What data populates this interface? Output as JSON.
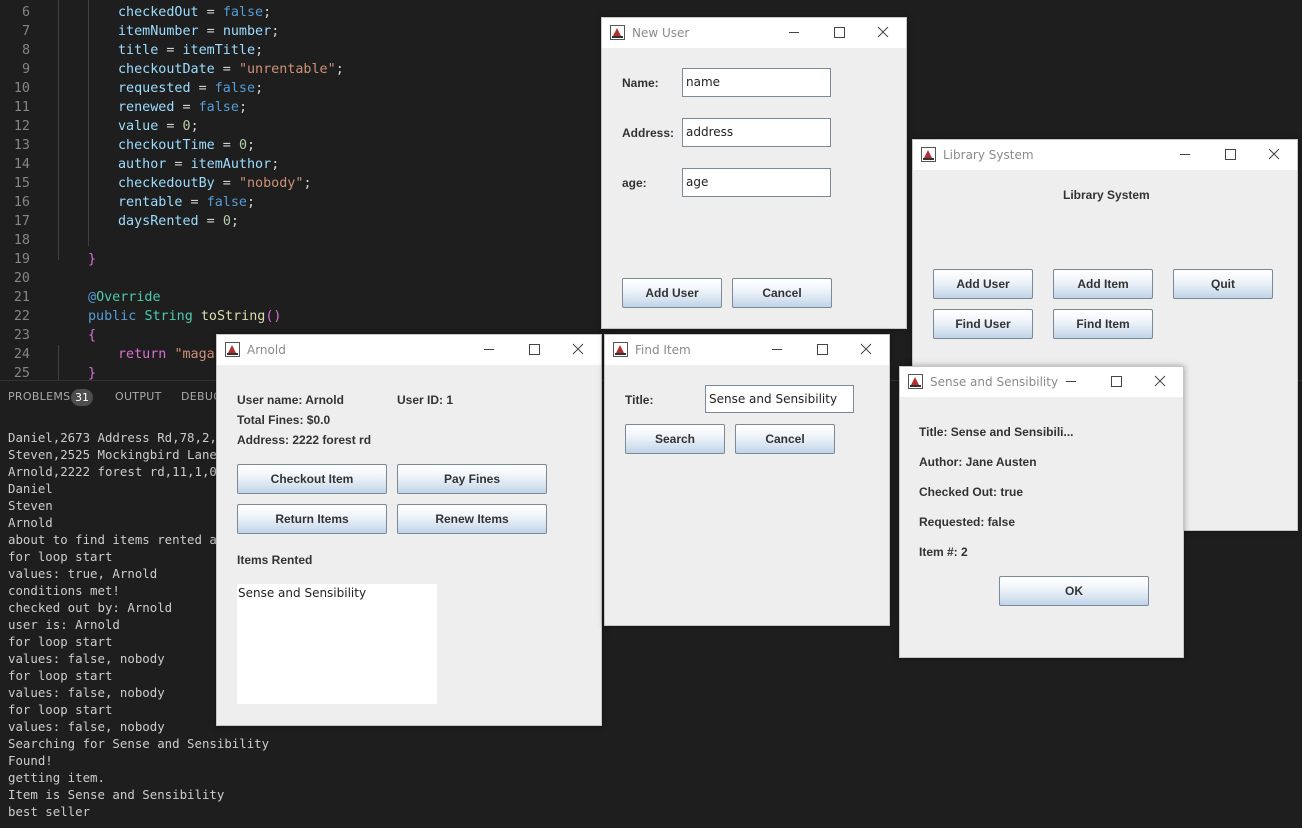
{
  "editor": {
    "lines": [
      {
        "num": "6",
        "tokens": [
          {
            "t": "checkedOut",
            "c": "v"
          },
          {
            "t": " = "
          },
          {
            "t": "false",
            "c": "k"
          },
          {
            "t": ";"
          }
        ]
      },
      {
        "num": "7",
        "tokens": [
          {
            "t": "itemNumber",
            "c": "v"
          },
          {
            "t": " = "
          },
          {
            "t": "number",
            "c": "v"
          },
          {
            "t": ";"
          }
        ]
      },
      {
        "num": "8",
        "tokens": [
          {
            "t": "title",
            "c": "v"
          },
          {
            "t": " = "
          },
          {
            "t": "itemTitle",
            "c": "v"
          },
          {
            "t": ";"
          }
        ]
      },
      {
        "num": "9",
        "tokens": [
          {
            "t": "checkoutDate",
            "c": "v"
          },
          {
            "t": " = "
          },
          {
            "t": "\"unrentable\"",
            "c": "s"
          },
          {
            "t": ";"
          }
        ]
      },
      {
        "num": "10",
        "tokens": [
          {
            "t": "requested",
            "c": "v"
          },
          {
            "t": " = "
          },
          {
            "t": "false",
            "c": "k"
          },
          {
            "t": ";"
          }
        ]
      },
      {
        "num": "11",
        "tokens": [
          {
            "t": "renewed",
            "c": "v"
          },
          {
            "t": " = "
          },
          {
            "t": "false",
            "c": "k"
          },
          {
            "t": ";"
          }
        ]
      },
      {
        "num": "12",
        "tokens": [
          {
            "t": "value",
            "c": "v"
          },
          {
            "t": " = "
          },
          {
            "t": "0",
            "c": "n"
          },
          {
            "t": ";"
          }
        ]
      },
      {
        "num": "13",
        "tokens": [
          {
            "t": "checkoutTime",
            "c": "v"
          },
          {
            "t": " = "
          },
          {
            "t": "0",
            "c": "n"
          },
          {
            "t": ";"
          }
        ]
      },
      {
        "num": "14",
        "tokens": [
          {
            "t": "author",
            "c": "v"
          },
          {
            "t": " = "
          },
          {
            "t": "itemAuthor",
            "c": "v"
          },
          {
            "t": ";"
          }
        ]
      },
      {
        "num": "15",
        "tokens": [
          {
            "t": "checkedoutBy",
            "c": "v"
          },
          {
            "t": " = "
          },
          {
            "t": "\"nobody\"",
            "c": "s"
          },
          {
            "t": ";"
          }
        ]
      },
      {
        "num": "16",
        "tokens": [
          {
            "t": "rentable",
            "c": "v"
          },
          {
            "t": " = "
          },
          {
            "t": "false",
            "c": "k"
          },
          {
            "t": ";"
          }
        ]
      },
      {
        "num": "17",
        "tokens": [
          {
            "t": "daysRented",
            "c": "v"
          },
          {
            "t": " = "
          },
          {
            "t": "0",
            "c": "n"
          },
          {
            "t": ";"
          }
        ]
      },
      {
        "num": "18",
        "tokens": []
      },
      {
        "num": "19",
        "tokens": [
          {
            "t": "}",
            "c": "b"
          }
        ]
      },
      {
        "num": "20",
        "tokens": []
      },
      {
        "num": "21",
        "tokens": [
          {
            "t": "@",
            "c": "k"
          },
          {
            "t": "Override",
            "c": "t"
          }
        ]
      },
      {
        "num": "22",
        "tokens": [
          {
            "t": "public",
            "c": "k"
          },
          {
            "t": " "
          },
          {
            "t": "String",
            "c": "t"
          },
          {
            "t": " "
          },
          {
            "t": "toString",
            "c": "f"
          },
          {
            "t": "()",
            "c": "b"
          }
        ]
      },
      {
        "num": "23",
        "tokens": [
          {
            "t": "{",
            "c": "b"
          }
        ]
      },
      {
        "num": "24",
        "tokens": [
          {
            "t": "return",
            "c": "b"
          },
          {
            "t": " "
          },
          {
            "t": "\"magaz",
            "c": "s"
          }
        ]
      },
      {
        "num": "25",
        "tokens": [
          {
            "t": "}",
            "c": "b"
          }
        ]
      }
    ]
  },
  "panel": {
    "tabs": {
      "problems": "PROBLEMS",
      "problems_count": "31",
      "output": "OUTPUT",
      "debug": "DEBUG"
    },
    "output_lines": [
      "Daniel,2673 Address Rd,78,2,0",
      "Steven,2525 Mockingbird Lane,2",
      "Arnold,2222 forest rd,11,1,0",
      "Daniel",
      "Steven",
      "Arnold",
      "about to find items rented and",
      "for loop start",
      "values: true, Arnold",
      "conditions met!",
      "checked out by: Arnold",
      "user is: Arnold",
      "for loop start",
      "values: false, nobody",
      "for loop start",
      "values: false, nobody",
      "for loop start",
      "values: false, nobody",
      "Searching for Sense and Sensibility",
      "Found!",
      "getting item.",
      "Item is Sense and Sensibility",
      "best seller"
    ]
  },
  "new_user": {
    "title": "New User",
    "name_label": "Name:",
    "name_value": "name",
    "address_label": "Address:",
    "address_value": "address",
    "age_label": "age:",
    "age_value": "age",
    "add_button": "Add User",
    "cancel_button": "Cancel"
  },
  "library": {
    "title": "Library System",
    "heading": "Library System",
    "add_user": "Add User",
    "add_item": "Add Item",
    "quit": "Quit",
    "find_user": "Find User",
    "find_item": "Find Item"
  },
  "arnold": {
    "title": "Arnold",
    "user_name": "User name: Arnold",
    "user_id": "User ID: 1",
    "fines": "Total Fines: $0.0",
    "address": "Address: 2222 forest rd",
    "checkout": "Checkout Item",
    "pay_fines": "Pay Fines",
    "return_items": "Return Items",
    "renew_items": "Renew Items",
    "items_rented_label": "Items Rented",
    "items_rented": [
      "Sense and Sensibility"
    ]
  },
  "find_item": {
    "title": "Find Item",
    "title_label": "Title:",
    "title_value": "Sense and Sensibility",
    "search": "Search",
    "cancel": "Cancel"
  },
  "sense": {
    "title": "Sense and Sensibility",
    "item_title": "Title: Sense and Sensibili...",
    "author": "Author: Jane Austen",
    "checked_out": "Checked Out: true",
    "requested": "Requested: false",
    "item_num": "Item #: 2",
    "ok": "OK"
  }
}
